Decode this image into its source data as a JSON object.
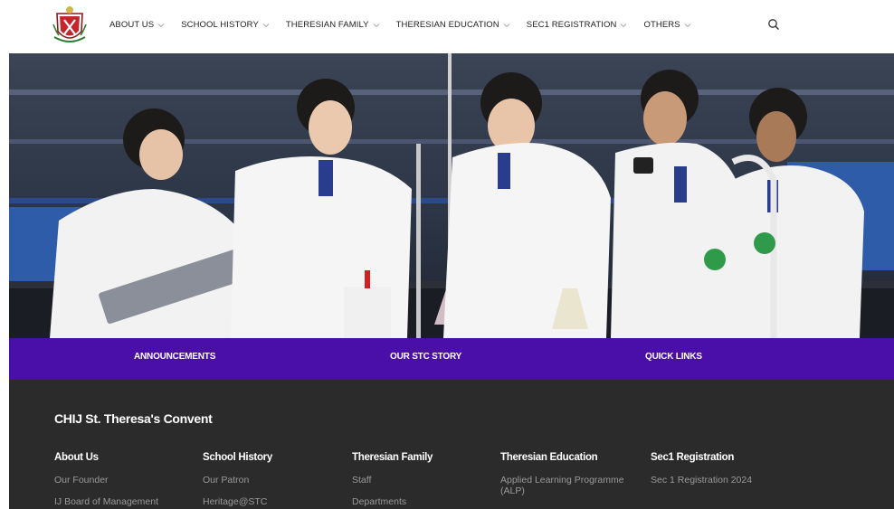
{
  "header": {
    "nav": [
      {
        "label": "ABOUT US"
      },
      {
        "label": "SCHOOL HISTORY"
      },
      {
        "label": "THERESIAN FAMILY"
      },
      {
        "label": "THERESIAN EDUCATION"
      },
      {
        "label": "SEC1 REGISTRATION"
      },
      {
        "label": "OTHERS"
      }
    ],
    "search_icon": "search-icon",
    "logo_icon": "school-crest"
  },
  "quick_bar": {
    "items": [
      {
        "label": "ANNOUNCEMENTS"
      },
      {
        "label": "OUR STC STORY"
      },
      {
        "label": "QUICK LINKS"
      }
    ],
    "color": "#4a0fa8"
  },
  "footer": {
    "title": "CHIJ St. Theresa's Convent",
    "columns": [
      {
        "heading": "About Us",
        "links": [
          "Our Founder",
          "IJ Board of Management"
        ]
      },
      {
        "heading": "School History",
        "links": [
          "Our Patron",
          "Heritage@STC"
        ]
      },
      {
        "heading": "Theresian Family",
        "links": [
          "Staff",
          "Departments"
        ]
      },
      {
        "heading": "Theresian Education",
        "links": [
          "Applied Learning Programme (ALP)"
        ]
      },
      {
        "heading": "Sec1 Registration",
        "links": [
          "Sec 1 Registration 2024"
        ]
      }
    ],
    "background": "#2b2b2b"
  }
}
